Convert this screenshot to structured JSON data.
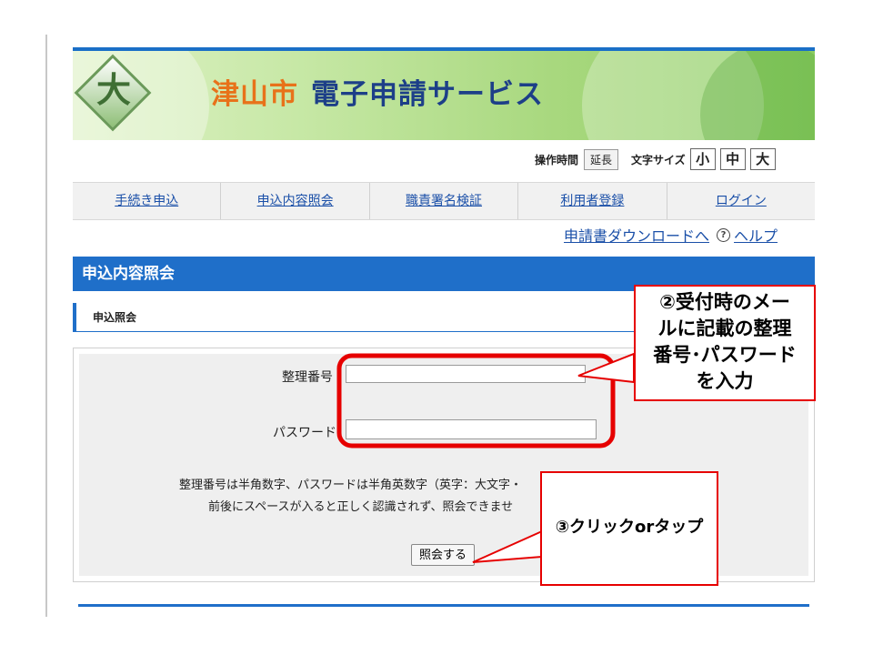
{
  "header": {
    "city": "津山市",
    "service": "電子申請サービス",
    "logo_char": "大"
  },
  "tools": {
    "hours_label": "操作時間",
    "extend_label": "延長",
    "fontsize_label": "文字サイズ",
    "sizes": [
      "小",
      "中",
      "大"
    ]
  },
  "nav": {
    "items": [
      "手続き申込",
      "申込内容照会",
      "職責署名検証",
      "利用者登録",
      "ログイン"
    ]
  },
  "subnav": {
    "download": "申請書ダウンロードへ",
    "help": "ヘルプ"
  },
  "page": {
    "title": "申込内容照会",
    "section": "申込照会"
  },
  "form": {
    "seiri_label": "整理番号",
    "seiri_value": "",
    "password_label": "パスワード",
    "password_value": "",
    "note1": "整理番号は半角数字、パスワードは半角英数字（英字：大文字・",
    "note2": "前後にスペースが入ると正しく認識されず、照会できませ",
    "submit_label": "照会する"
  },
  "annotations": {
    "step2_lines": [
      "②受付時のメー",
      "ルに記載の整理",
      "番号･パスワード",
      "を入力"
    ],
    "step3": "③クリックorタップ"
  },
  "colors": {
    "accent": "#1f6fc9",
    "annotation": "#e60000",
    "city": "#e8721a",
    "service": "#1d3f88"
  }
}
